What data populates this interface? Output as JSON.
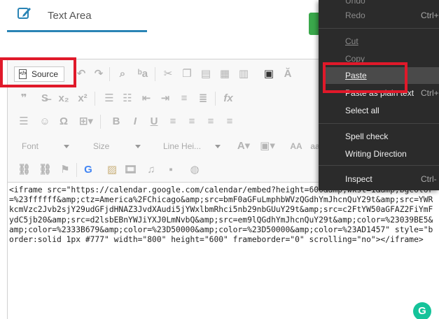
{
  "tab": {
    "label": "Text Area"
  },
  "toolbar": {
    "source_label": "Source",
    "doc_icon_text": "</>",
    "font_label": "Font",
    "size_label": "Size",
    "line_height_label": "Line Hei..."
  },
  "editor": {
    "source_text": "<iframe src=\"https://calendar.google.com/calendar/embed?height=600&amp;wkst=1&amp;bgcolor=%23ffffff&amp;ctz=America%2FChicago&amp;src=bmF0aGFuLmphbWVzQGdhYmJhcnQuY29t&amp;src=YWRkcmVzc2Jvb2sjY29udGFjdHNAZ3JvdXAudi5jYWxlbmRhci5nb29nbGUuY29t&amp;src=c2FtYW50aGFAZ2FiYmFydC5jb20&amp;src=d2lsbEBnYWJiYXJ0LmNvbQ&amp;src=em9lQGdhYmJhcnQuY29t&amp;color=%23039BE5&amp;color=%2333B679&amp;color=%23D50000&amp;color=%23D50000&amp;color=%23AD1457\" style=\"border:solid 1px #777\" width=\"800\" height=\"600\" frameborder=\"0\" scrolling=\"no\"></iframe>"
  },
  "context_menu": {
    "undo": "Undo",
    "redo": "Redo",
    "redo_shortcut": "Ctrl+",
    "cut": "Cut",
    "copy": "Copy",
    "paste": "Paste",
    "paste_plain": "Paste as plain text",
    "paste_plain_shortcut": "Ctrl+",
    "select_all": "Select all",
    "spell_check": "Spell check",
    "writing_direction": "Writing Direction",
    "inspect": "Inspect",
    "inspect_shortcut": "Ctrl-"
  },
  "grammarly": {
    "letter": "G"
  },
  "colors": {
    "highlight": "#e0192a",
    "tab_underline": "#2a84b5",
    "menu_bg": "#2b2b2b",
    "grammarly": "#15c39a"
  }
}
